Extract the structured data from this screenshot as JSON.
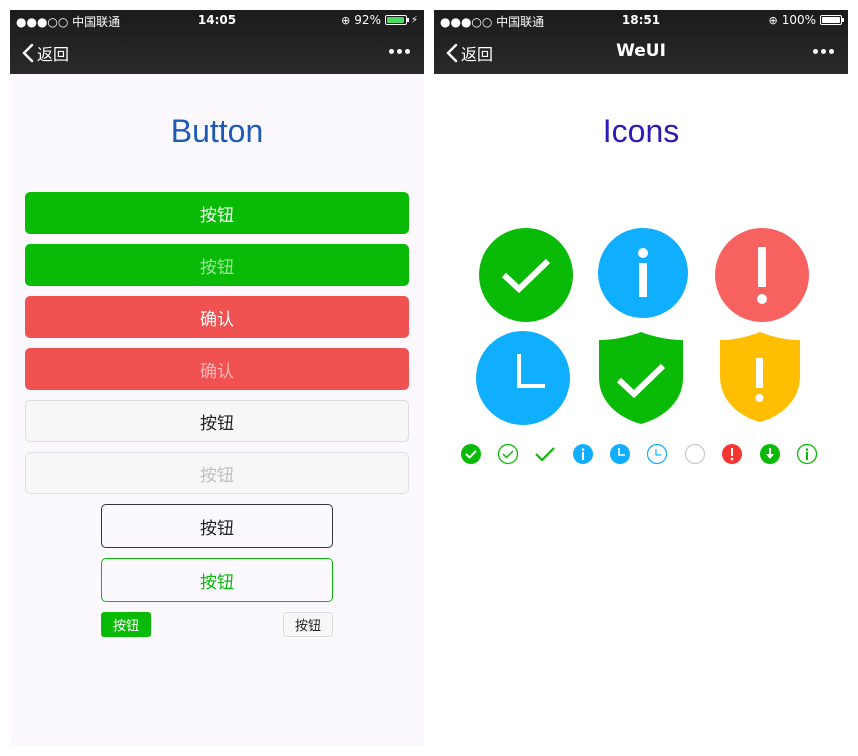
{
  "left": {
    "status": {
      "carrier": "●●●○○ 中国联通",
      "time": "14:05",
      "battery_text": "92%",
      "battery_level": 0.92
    },
    "nav": {
      "back_label": "返回",
      "title": ""
    },
    "page_title": "Button",
    "buttons": {
      "primary": "按钮",
      "primary_disabled": "按钮",
      "warn": "确认",
      "warn_disabled": "确认",
      "default": "按钮",
      "default_disabled": "按钮",
      "plain_default": "按钮",
      "plain_primary": "按钮",
      "mini_primary": "按钮",
      "mini_default": "按钮"
    }
  },
  "right": {
    "status": {
      "carrier": "●●●○○ 中国联通",
      "time": "18:51",
      "battery_text": "100%",
      "battery_level": 1.0
    },
    "nav": {
      "back_label": "返回",
      "title": "WeUI"
    },
    "page_title": "Icons",
    "large_icons": [
      "success-icon",
      "info-icon",
      "warn-icon",
      "waiting-icon",
      "safe-success-icon",
      "safe-warn-icon"
    ],
    "small_icons": [
      "success-icon",
      "success-circle-icon",
      "success-no-circle-icon",
      "info-circle-icon",
      "waiting-icon",
      "waiting-circle-icon",
      "circle-icon",
      "warn-icon",
      "download-icon",
      "info-outline-icon"
    ]
  },
  "colors": {
    "primary": "#09bb07",
    "warn": "#f05252",
    "blue": "#10aeff",
    "red": "#f76260",
    "yellow": "#ffbe00",
    "title_blue": "#1e5bb6",
    "title_purple": "#2c1ab8"
  }
}
